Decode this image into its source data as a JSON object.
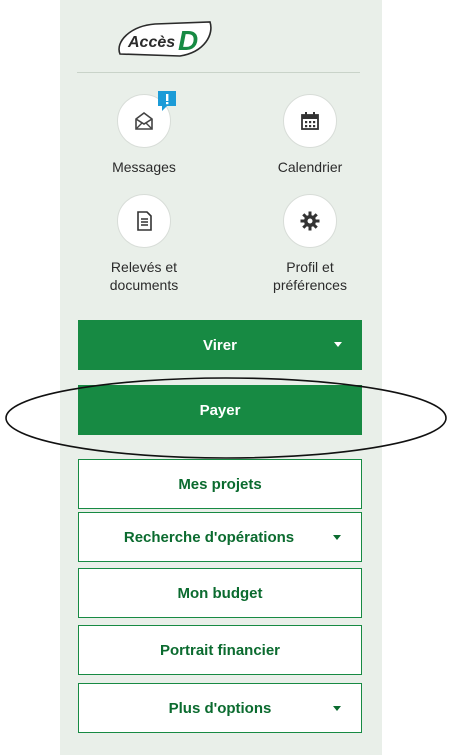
{
  "logo": {
    "text_left": "Accès",
    "text_right": "D"
  },
  "shortcuts": [
    {
      "label": "Messages"
    },
    {
      "label": "Calendrier"
    },
    {
      "label_line1": "Relevés et",
      "label_line2": "documents"
    },
    {
      "label_line1": "Profil et",
      "label_line2": "préférences"
    }
  ],
  "menu": {
    "virer": "Virer",
    "payer": "Payer",
    "mes_projets": "Mes projets",
    "recherche": "Recherche d'opérations",
    "mon_budget": "Mon budget",
    "portrait": "Portrait financier",
    "plus_options": "Plus d'options"
  },
  "colors": {
    "brand_green": "#178a43",
    "text_green": "#0b6b2f",
    "panel_bg": "#e9efe9",
    "badge": "#1b9bd7"
  }
}
